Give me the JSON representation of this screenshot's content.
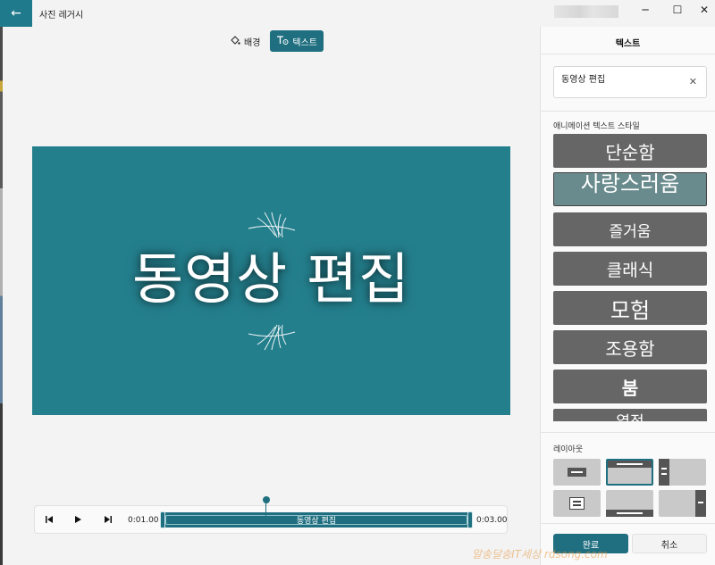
{
  "titlebar": {
    "app_title": "사진 레거시",
    "back_icon": "←",
    "minimize_icon": "─",
    "maximize_icon": "☐",
    "close_icon": "✕"
  },
  "modes": [
    {
      "label": "배경",
      "icon": "paint-bucket-icon",
      "active": false
    },
    {
      "label": "텍스트",
      "icon": "text-icon",
      "active": true
    }
  ],
  "canvas": {
    "title_text": "동영상 편집",
    "background": "#247f8d"
  },
  "timeline": {
    "start_time": "0:01.00",
    "end_time": "0:03.00",
    "clip_label": "동영상 편집"
  },
  "panel": {
    "title": "텍스트",
    "text_value": "동영상 편집",
    "clear_icon": "✕",
    "styles_label": "애니메이션 텍스트 스타일",
    "styles": [
      "단순함",
      "사랑스러움",
      "즐거움",
      "클래식",
      "모험",
      "조용함",
      "붐",
      "열정"
    ],
    "selected_style": "사랑스러움",
    "layout_label": "레이아웃",
    "done_label": "완료",
    "cancel_label": "취소"
  },
  "watermark": "알송달송IT세상 rdsong.com",
  "colors": {
    "accent": "#1f6f80",
    "tile": "#666666"
  }
}
